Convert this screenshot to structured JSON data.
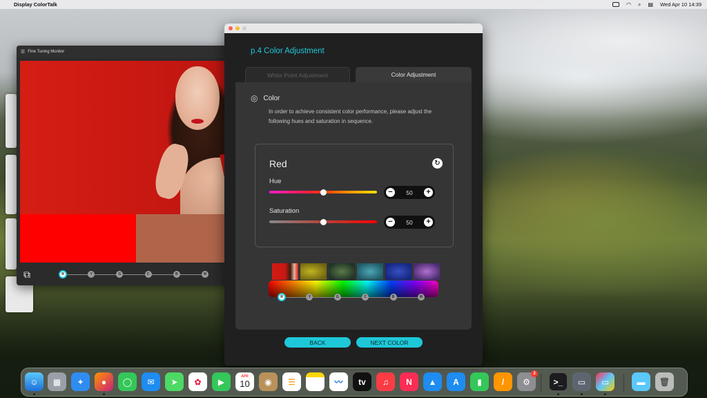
{
  "menubar": {
    "app_name": "Display ColorTalk",
    "datetime": "Wed Apr 10  14:39"
  },
  "monitor_window": {
    "title": "Fine Tuning Monitor",
    "steps": [
      "R",
      "Y",
      "G",
      "C",
      "B",
      "M"
    ],
    "active_step": 0,
    "swatch_left_color": "#ff0000",
    "swatch_right_color": "#b0654a"
  },
  "main_window": {
    "step_title": "p.4 Color Adjustment",
    "tabs": [
      {
        "label": "White Point Adjustment",
        "active": false
      },
      {
        "label": "Color Adjustment",
        "active": true
      }
    ],
    "section_title": "Color",
    "description": "In order to achieve consistent color performance, please adjust the following hues and saturation in sequence.",
    "adjust": {
      "color_name": "Red",
      "hue": {
        "label": "Hue",
        "value": "50",
        "level": 50
      },
      "saturation": {
        "label": "Saturation",
        "value": "50",
        "level": 50
      }
    },
    "steps": [
      "R",
      "Y",
      "G",
      "C",
      "B",
      "M"
    ],
    "active_step": 0,
    "back_label": "BACK",
    "next_label": "NEXT COLOR"
  },
  "dock": {
    "calendar_month": "APR",
    "calendar_day": "10",
    "settings_badge": "2"
  },
  "accent_color": "#1ec8d8"
}
